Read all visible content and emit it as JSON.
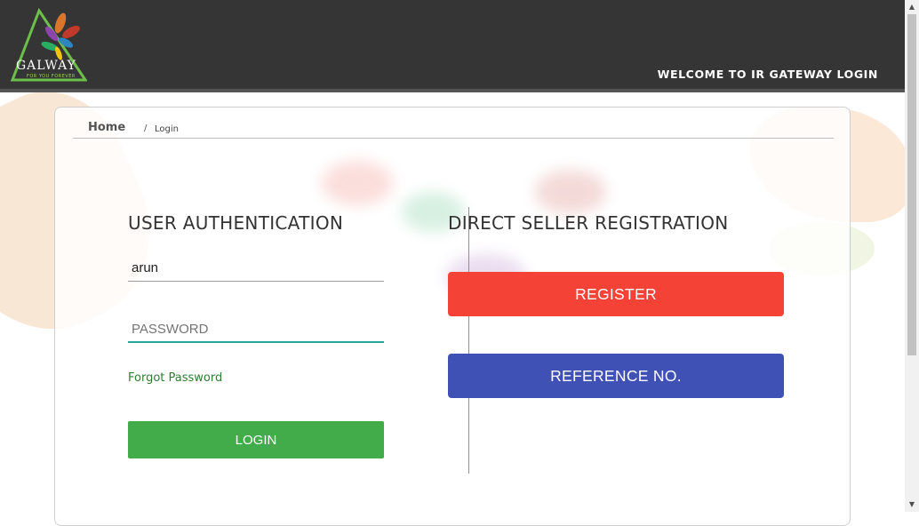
{
  "header": {
    "logo_text": "GALWAY",
    "logo_tagline": "FOR YOU FOREVER",
    "welcome": "WELCOME TO IR GATEWAY LOGIN"
  },
  "breadcrumb": {
    "home": "Home",
    "separator": "/",
    "current": "Login"
  },
  "auth": {
    "title": "USER AUTHENTICATION",
    "username_value": "arun",
    "password_placeholder": "PASSWORD",
    "forgot_label": "Forgot Password",
    "login_label": "LOGIN"
  },
  "registration": {
    "title": "DIRECT SELLER REGISTRATION",
    "register_label": "REGISTER",
    "reference_label": "REFERENCE NO."
  },
  "colors": {
    "header": "#353535",
    "login_button": "#43ac4a",
    "register_button": "#f44336",
    "reference_button": "#3f51b5",
    "forgot_link": "#2e7d32",
    "focus_underline": "#26a69a"
  }
}
